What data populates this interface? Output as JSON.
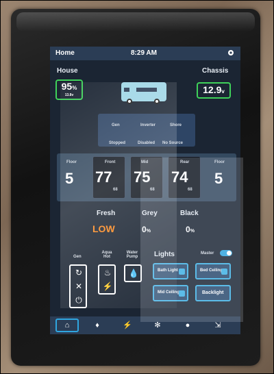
{
  "topbar": {
    "home": "Home",
    "time": "8:29 AM"
  },
  "house": {
    "label": "House",
    "value": "95",
    "unit": "%",
    "sub": "13.8v"
  },
  "chassis": {
    "label": "Chassis",
    "value": "12.9",
    "unit": "v"
  },
  "power": {
    "labels": [
      "Gen",
      "Inverter",
      "Shore"
    ],
    "states": [
      "Stopped",
      "Disabled",
      "No Source"
    ]
  },
  "temps": {
    "floor_left": {
      "label": "Floor",
      "value": "5"
    },
    "front": {
      "label": "Front",
      "value": "77",
      "set": "68"
    },
    "mid": {
      "label": "Mid",
      "value": "75",
      "set": "68"
    },
    "rear": {
      "label": "Rear",
      "value": "74",
      "set": "68"
    },
    "floor_right": {
      "label": "Floor",
      "value": "5"
    }
  },
  "tanks": {
    "fresh": {
      "label": "Fresh",
      "value": "LOW"
    },
    "grey": {
      "label": "Grey",
      "value": "0",
      "unit": "%"
    },
    "black": {
      "label": "Black",
      "value": "0",
      "unit": "%"
    }
  },
  "controls": {
    "gen": "Gen",
    "aqua_hot": "Aqua Hot",
    "water_pump": "Water Pump"
  },
  "lights": {
    "title": "Lights",
    "master": "Master",
    "buttons": [
      "Bath Light",
      "Bed Ceiling",
      "Mid Ceiling",
      "Backlight"
    ]
  },
  "nav": {
    "icons": [
      "home-icon",
      "bulb-icon",
      "bolt-icon",
      "snowflake-icon",
      "chat-icon",
      "slider-icon"
    ]
  }
}
